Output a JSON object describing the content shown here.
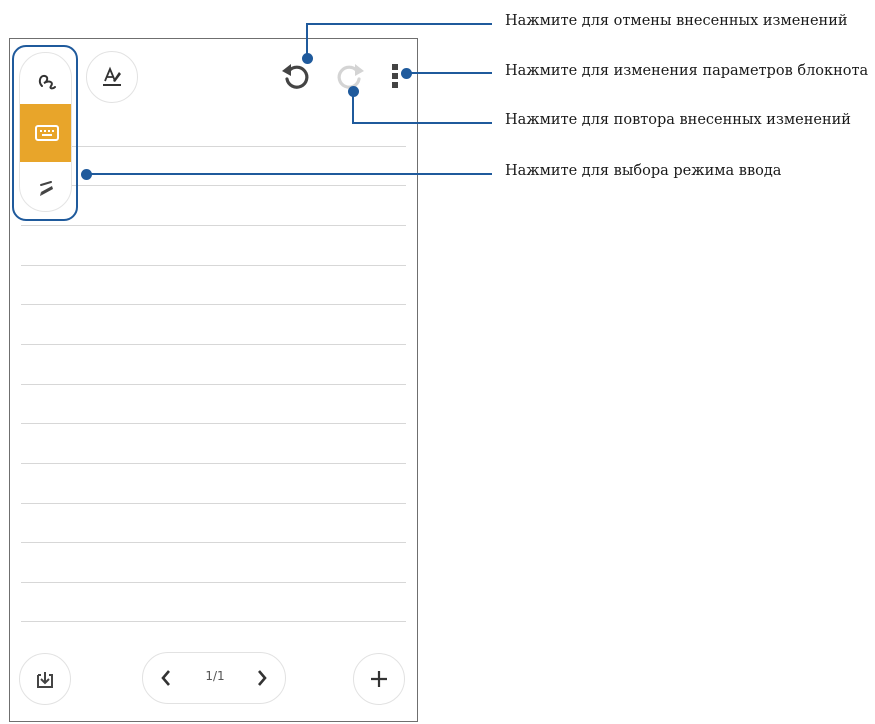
{
  "toolbar": {
    "handwriting_icon": "handwriting-icon",
    "keyboard_icon": "keyboard-icon",
    "highlighter_icon": "highlighter-icon",
    "text_style_icon": "text-style-icon",
    "undo_icon": "undo-icon",
    "redo_icon": "redo-icon",
    "more_icon": "more-vertical-icon"
  },
  "bottom_bar": {
    "import_icon": "import-icon",
    "prev_icon": "chevron-left-icon",
    "next_icon": "chevron-right-icon",
    "page_indicator": "1/1",
    "add_icon": "plus-icon"
  },
  "callouts": {
    "undo": "Нажмите для отмены внесенных изменений",
    "settings": "Нажмите для изменения параметров блокнота",
    "redo": "Нажмите для повтора внесенных изменений",
    "input_mode": "Нажмите для выбора режима ввода"
  },
  "colors": {
    "accent": "#e8a52a",
    "callout": "#1f5a9c"
  }
}
